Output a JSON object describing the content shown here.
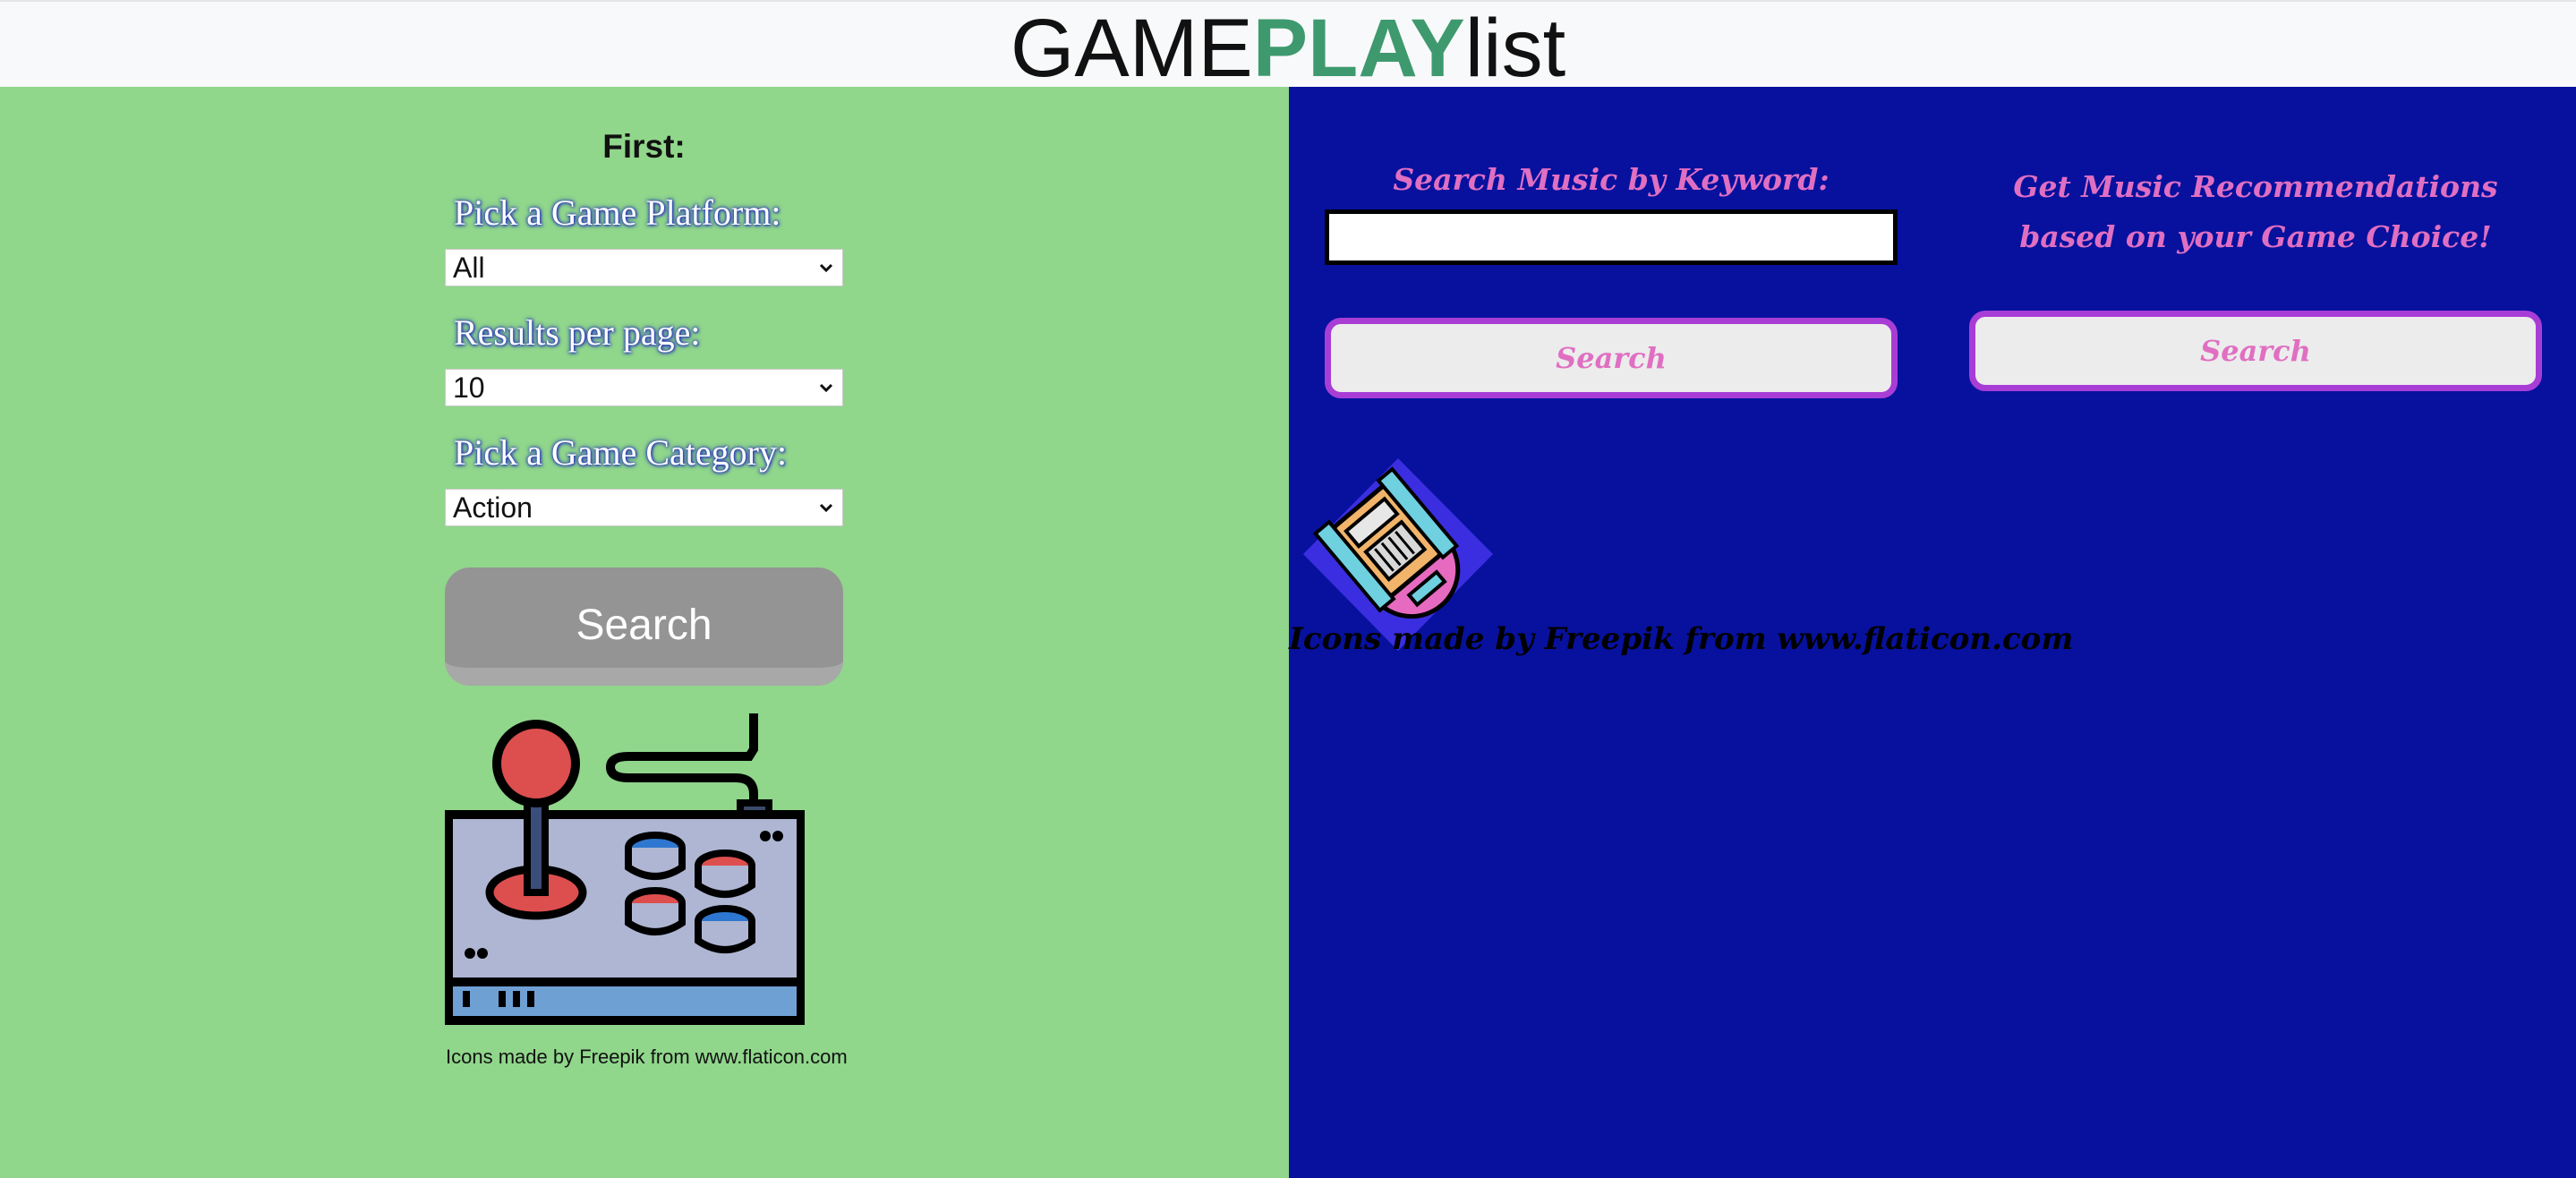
{
  "header": {
    "logo_part1": "GAME",
    "logo_part2": "PLAY",
    "logo_part3": "list"
  },
  "left": {
    "first_label": "First:",
    "platform_label": "Pick a Game Platform:",
    "platform_value": "All",
    "results_label": "Results per page:",
    "results_value": "10",
    "category_label": "Pick a Game Category:",
    "category_value": "Action",
    "search_button": "Search",
    "controller_icon": "arcade-controller-icon",
    "credit": "Icons made by Freepik from www.flaticon.com"
  },
  "right": {
    "keyword_label": "Search Music by Keyword:",
    "keyword_value": "",
    "keyword_search_button": "Search",
    "recommend_label": "Get Music Recommendations based on your Game Choice!",
    "recommend_search_button": "Search",
    "jukebox_icon": "jukebox-icon",
    "credit": "Icons made by Freepik from www.flaticon.com"
  },
  "colors": {
    "left_bg": "#90d68b",
    "right_bg": "#07119e",
    "accent_green": "#3e9a6e",
    "pink_text": "#e06fc2",
    "purple_border": "#a83dd6"
  }
}
